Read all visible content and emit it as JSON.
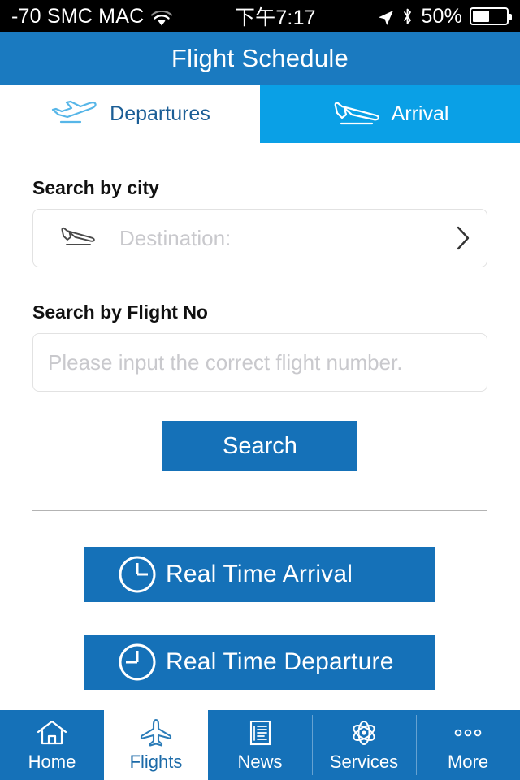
{
  "status_bar": {
    "carrier": "-70 SMC MAC",
    "time": "下午7:17",
    "battery_percent": "50%",
    "wifi_icon": "wifi-icon",
    "location_icon": "location-arrow-icon",
    "bluetooth_icon": "bluetooth-icon",
    "battery_icon": "battery-icon"
  },
  "header": {
    "title": "Flight Schedule"
  },
  "tabs": [
    {
      "label": "Departures",
      "icon": "airplane-takeoff-icon",
      "active": false
    },
    {
      "label": "Arrival",
      "icon": "airplane-landing-icon",
      "active": true
    }
  ],
  "search_city": {
    "label": "Search by city",
    "placeholder": "Destination:",
    "value": "",
    "icon": "airplane-landing-icon",
    "chevron": "chevron-right-icon"
  },
  "search_flight": {
    "label": "Search by Flight No",
    "placeholder": "Please input the correct flight number.",
    "value": ""
  },
  "search_button": {
    "label": "Search"
  },
  "realtime": [
    {
      "label": "Real Time Arrival",
      "icon": "clock-icon"
    },
    {
      "label": "Real Time Departure",
      "icon": "clock-icon"
    }
  ],
  "bottom_nav": [
    {
      "label": "Home",
      "icon": "home-icon",
      "active": false
    },
    {
      "label": "Flights",
      "icon": "airplane-icon",
      "active": true
    },
    {
      "label": "News",
      "icon": "document-icon",
      "active": false
    },
    {
      "label": "Services",
      "icon": "atom-icon",
      "active": false
    },
    {
      "label": "More",
      "icon": "ellipsis-icon",
      "active": false
    }
  ],
  "colors": {
    "header_blue": "#1a7ac0",
    "tab_active_blue": "#0aa0e6",
    "button_blue": "#1571b8",
    "nav_blue": "#1571b8",
    "placeholder_gray": "#c9c9cd",
    "divider_gray": "#b3b3b3"
  }
}
